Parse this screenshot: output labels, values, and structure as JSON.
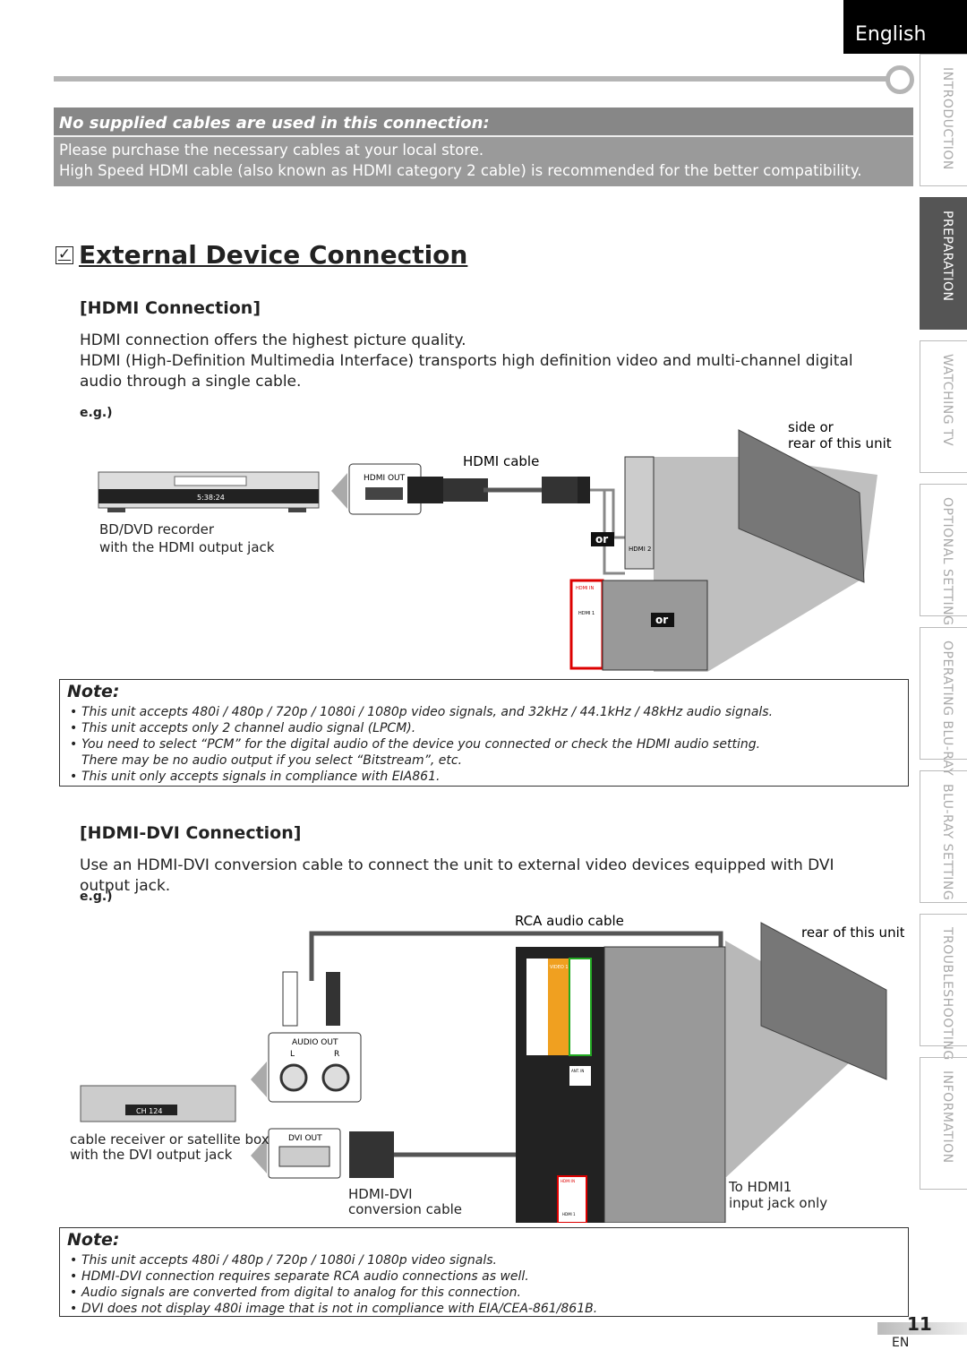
{
  "language_tab": "English",
  "side_tabs": [
    {
      "label": "INTRODUCTION",
      "active": false
    },
    {
      "label": "PREPARATION",
      "active": true
    },
    {
      "label": "WATCHING TV",
      "active": false
    },
    {
      "label": "OPTIONAL SETTING",
      "active": false
    },
    {
      "label": "OPERATING BLU-RAY",
      "active": false
    },
    {
      "label": "BLU-RAY SETTING",
      "active": false
    },
    {
      "label": "TROUBLESHOOTING",
      "active": false
    },
    {
      "label": "INFORMATION",
      "active": false
    }
  ],
  "cables_box": {
    "heading": "No supplied cables are used in this connection:",
    "lines": [
      "Please purchase the necessary cables at your local store.",
      "High Speed HDMI cable (also known as HDMI category 2 cable) is recommended for the better compatibility."
    ]
  },
  "section_title": "External Device Connection",
  "checkbox_icon": "check-box",
  "hdmi": {
    "heading": "[HDMI Connection]",
    "paragraph": [
      "HDMI connection offers the highest picture quality.",
      "HDMI (High-Definition Multimedia Interface) transports high definition video and multi-channel digital audio through a single cable."
    ],
    "eg": "e.g.)",
    "diagram": {
      "cable_label": "HDMI cable",
      "unit_label": [
        "side or",
        "rear of this unit"
      ],
      "device_label": [
        "BD/DVD recorder",
        "with the HDMI output jack"
      ],
      "jack_label": "HDMI OUT",
      "or": "or",
      "display": "5:38:24",
      "hdmi1": "HDMI 1",
      "hdmi2": "HDMI 2",
      "hdmi_in": "HDMI IN"
    },
    "note": {
      "title": "Note:",
      "items": [
        "This unit accepts 480i / 480p / 720p / 1080i / 1080p video signals, and 32kHz / 44.1kHz / 48kHz audio signals.",
        "This unit accepts only 2 channel audio signal (LPCM).",
        "You need to select “PCM” for the digital audio of the device you connected or check the HDMI audio setting.",
        "There may be no audio output if you select “Bitstream”, etc.",
        "This unit only accepts signals in compliance with EIA861."
      ]
    }
  },
  "hdmi_dvi": {
    "heading": "[HDMI-DVI Connection]",
    "paragraph": "Use an HDMI-DVI conversion cable to connect the unit to external video devices equipped with DVI output jack.",
    "eg": "e.g.)",
    "diagram": {
      "rca_label": "RCA audio cable",
      "unit_label": "rear of this unit",
      "device_label": [
        "cable receiver or satellite box",
        "with the DVI output jack"
      ],
      "audio_out": "AUDIO OUT",
      "l": "L",
      "r": "R",
      "dvi_out": "DVI OUT",
      "conv_label": [
        "HDMI-DVI",
        "conversion cable"
      ],
      "to_hdmi1": [
        "To HDMI1",
        "input jack only"
      ],
      "video1": "VIDEO 1",
      "ant_in": "ANT. IN",
      "hdmi_in": "HDMI IN",
      "hdmi1": "HDMI 1",
      "display": "CH 124"
    },
    "note": {
      "title": "Note:",
      "items": [
        "This unit accepts 480i / 480p / 720p / 1080i / 1080p video signals.",
        "HDMI-DVI connection requires separate RCA audio connections as well.",
        "Audio signals are converted from digital to analog for this connection.",
        "DVI does not display 480i image that is not in compliance with EIA/CEA-861/861B."
      ]
    }
  },
  "page_number": "11",
  "page_lang": "EN"
}
